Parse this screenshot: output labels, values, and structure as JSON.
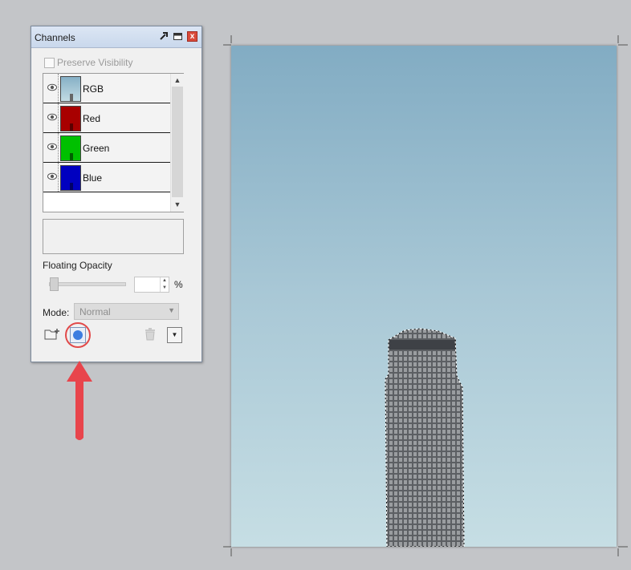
{
  "panel": {
    "title": "Channels",
    "preserve_visibility_label": "Preserve Visibility",
    "channels": [
      {
        "name": "RGB",
        "color": "#a9c8d6"
      },
      {
        "name": "Red",
        "color": "#c00000"
      },
      {
        "name": "Green",
        "color": "#00c000"
      },
      {
        "name": "Blue",
        "color": "#0000c8"
      }
    ],
    "floating_opacity_label": "Floating Opacity",
    "opacity_unit": "%",
    "mode_label": "Mode:",
    "mode_value": "Normal",
    "buttons": {
      "new_folder_icon": "folder-add-icon",
      "save_mask_icon": "save-selection-as-mask-icon",
      "delete_icon": "trash-icon",
      "menu_icon": "dropdown-menu-icon"
    }
  },
  "annotation": {
    "color": "#e8454c"
  },
  "canvas": {
    "sky_top": "#82acc3",
    "sky_bottom": "#c6dee4"
  }
}
